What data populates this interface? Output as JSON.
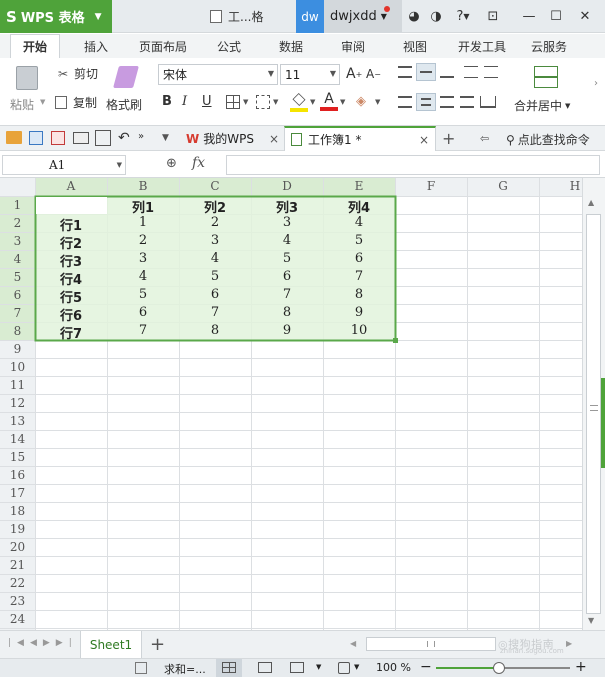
{
  "titlebar": {
    "app_name": "WPS 表格",
    "doc_tab": "工...格",
    "user_badge": "dw",
    "user_name": "dwjxdd",
    "help": "?"
  },
  "ribbon_tabs": [
    "开始",
    "插入",
    "页面布局",
    "公式",
    "数据",
    "审阅",
    "视图",
    "开发工具",
    "云服务"
  ],
  "ribbon": {
    "paste": "粘贴",
    "cut": "剪切",
    "copy": "复制",
    "format_painter": "格式刷",
    "font_name": "宋体",
    "font_size": "11",
    "bold": "B",
    "italic": "I",
    "underline": "U",
    "merge_center": "合并居中"
  },
  "doc_tabs": {
    "my_wps": "我的WPS",
    "workbook": "工作簿1 *",
    "search_cmd": "点此查找命令"
  },
  "formula_bar": {
    "name_box": "A1",
    "fx": "fx",
    "value": ""
  },
  "grid": {
    "columns": [
      "A",
      "B",
      "C",
      "D",
      "E",
      "F",
      "G",
      "H"
    ],
    "row_numbers": [
      "1",
      "2",
      "3",
      "4",
      "5",
      "6",
      "7",
      "8",
      "9",
      "10",
      "11",
      "12",
      "13",
      "14",
      "15",
      "16",
      "17",
      "18",
      "19",
      "20",
      "21",
      "22",
      "23",
      "24"
    ],
    "header_row": [
      "",
      "列1",
      "列2",
      "列3",
      "列4"
    ],
    "rows": [
      [
        "行1",
        "1",
        "2",
        "3",
        "4"
      ],
      [
        "行2",
        "2",
        "3",
        "4",
        "5"
      ],
      [
        "行3",
        "3",
        "4",
        "5",
        "6"
      ],
      [
        "行4",
        "4",
        "5",
        "6",
        "7"
      ],
      [
        "行5",
        "5",
        "6",
        "7",
        "8"
      ],
      [
        "行6",
        "6",
        "7",
        "8",
        "9"
      ],
      [
        "行7",
        "7",
        "8",
        "9",
        "10"
      ]
    ],
    "selection_fill": "#e2f3dc",
    "selection_border": "#5aa84a"
  },
  "sheet_bar": {
    "sheet_name": "Sheet1",
    "add": "+"
  },
  "status_bar": {
    "sum": "求和=...",
    "zoom": "100 %",
    "zoom_fraction": 0.47
  },
  "watermark": "zhinan.sogou.com"
}
